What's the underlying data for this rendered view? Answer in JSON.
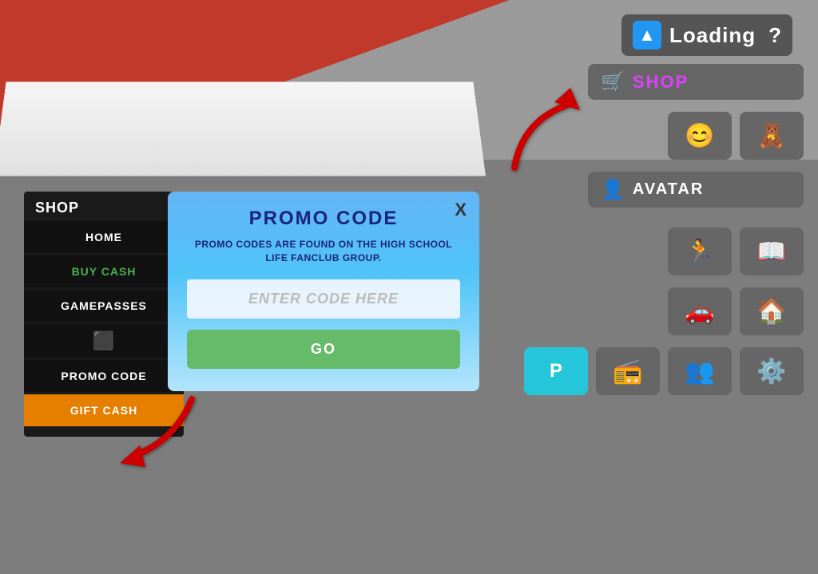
{
  "game": {
    "background_color": "#888888",
    "floor_color": "#7d7d7d"
  },
  "loading": {
    "label": "Loading",
    "question": "?",
    "icon": "▲"
  },
  "top_right": {
    "shop_label": "SHOP",
    "avatar_label": "AVATAR"
  },
  "shop_panel": {
    "title": "SHOP",
    "close_label": "X",
    "menu_items": [
      {
        "id": "home",
        "label": "HOME",
        "style": "normal"
      },
      {
        "id": "buy-cash",
        "label": "BUY CASH",
        "style": "green"
      },
      {
        "id": "gamepasses",
        "label": "GAMEPASSES",
        "style": "normal"
      },
      {
        "id": "icon",
        "label": "⬜",
        "style": "icon"
      },
      {
        "id": "promo-code",
        "label": "PROMO CODE",
        "style": "normal"
      },
      {
        "id": "gift-cash",
        "label": "GIFT CASH",
        "style": "gift"
      }
    ]
  },
  "promo_modal": {
    "title": "PROMO CODE",
    "description": "PROMO CODES ARE FOUND ON THE HIGH SCHOOL LIFE FANCLUB GROUP.",
    "input_placeholder": "ENTER CODE HERE",
    "go_button": "GO",
    "close": "X"
  },
  "icon_buttons": {
    "row1": [
      "😊",
      "🧸"
    ],
    "row2": [
      "🏃",
      "📖"
    ],
    "row3": [
      "🚗",
      "🏠"
    ],
    "row4_teal": [
      "P"
    ],
    "row4_normal": [
      "📻",
      "👥",
      "⚙️"
    ]
  }
}
